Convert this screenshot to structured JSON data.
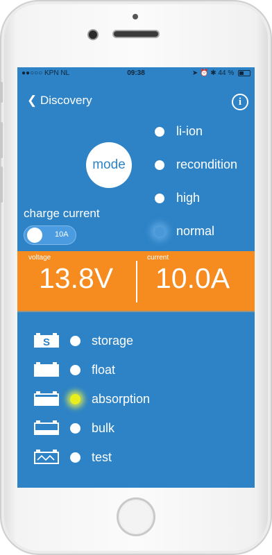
{
  "status_bar": {
    "carrier": "●●○○○ KPN NL",
    "time": "09:38",
    "battery": "44 %"
  },
  "nav": {
    "back_label": "Discovery",
    "info_icon": "info-icon"
  },
  "mode": {
    "button_label": "mode",
    "selected": "normal",
    "options": [
      "li-ion",
      "recondition",
      "high",
      "normal"
    ]
  },
  "charge": {
    "label": "charge current",
    "toggle_value": "10A"
  },
  "readings": {
    "voltage_caption": "voltage",
    "voltage_value": "13.8V",
    "current_caption": "current",
    "current_value": "10.0A"
  },
  "states": {
    "active": "absorption",
    "items": [
      {
        "label": "storage",
        "icon": "battery-storage-icon",
        "icon_text": "S"
      },
      {
        "label": "float",
        "icon": "battery-float-icon"
      },
      {
        "label": "absorption",
        "icon": "battery-absorption-icon"
      },
      {
        "label": "bulk",
        "icon": "battery-bulk-icon"
      },
      {
        "label": "test",
        "icon": "battery-test-icon"
      }
    ]
  },
  "colors": {
    "screen_bg": "#2d83c6",
    "readings_band": "#f68c1f",
    "active_led": "#e8ef1c"
  }
}
